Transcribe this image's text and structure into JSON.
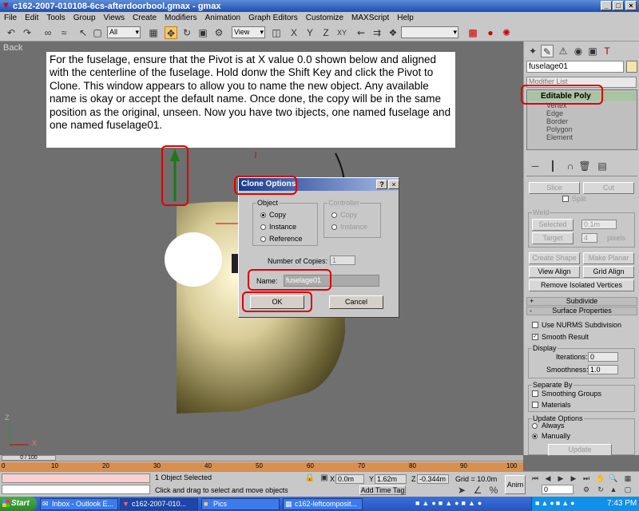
{
  "window": {
    "title": "c162-2007-010108-6cs-afterdoorbool.gmax - gmax",
    "min": "_",
    "max": "□",
    "close": "×"
  },
  "menu": [
    "File",
    "Edit",
    "Tools",
    "Group",
    "Views",
    "Create",
    "Modifiers",
    "Animation",
    "Graph Editors",
    "Customize",
    "MAXScript",
    "Help"
  ],
  "toolbar": {
    "filter_value": "All",
    "coord_value": "View"
  },
  "viewport": {
    "label": "Back",
    "instruction": "For the fuselage, ensure that the Pivot is at X value 0.0 shown below and aligned with the centerline of the fuselage.  Hold donw the Shift Key and click the Pivot to Clone.  This window appears to allow you to name the new object.  Any available name is okay or accept the default name.  Once done, the copy will be in the same position as the original, unseen.  Now you have two ibjects, one named fuselage and one named fuselage01.",
    "axis_z": "Z",
    "axis_x": "X"
  },
  "dialog": {
    "title": "Clone Options",
    "help": "?",
    "close": "×",
    "object_label": "Object",
    "object_options": [
      "Copy",
      "Instance",
      "Reference"
    ],
    "controller_label": "Controller",
    "controller_options": [
      "Copy",
      "Instance"
    ],
    "copies_label": "Number of Copies:",
    "copies_value": "1",
    "name_label": "Name:",
    "name_value": "fuselage01",
    "ok": "OK",
    "cancel": "Cancel"
  },
  "panel": {
    "object_name": "fuselage01",
    "modifier_list": "Modifier List",
    "stack_top": "Editable Poly",
    "stack_items": [
      "Vertex",
      "Edge",
      "Border",
      "Polygon",
      "Element"
    ],
    "slice": "Slice",
    "cut": "Cut",
    "split": "Split",
    "weld": "Weld",
    "selected": "Selected",
    "weld_value": "0.1m",
    "target": "Target",
    "target_value": "4",
    "pixels": "pixels",
    "create_shape": "Create Shape",
    "make_planar": "Make Planar",
    "view_align": "View Align",
    "grid_align": "Grid Align",
    "remove_isolated": "Remove Isolated Vertices",
    "subdivide": "Subdivide",
    "surface_properties": "Surface Properties",
    "use_nurms": "Use NURMS Subdivision",
    "smooth_result": "Smooth Result",
    "display": "Display",
    "iterations": "Iterations:",
    "iterations_value": "0",
    "smoothness": "Smoothness:",
    "smoothness_value": "1.0",
    "separate_by": "Separate By",
    "smoothing_groups": "Smoothing Groups",
    "materials": "Materials",
    "update_options": "Update Options",
    "always": "Always",
    "manually": "Manually",
    "update": "Update",
    "plus": "+",
    "minus": "-"
  },
  "timeline": {
    "frame": "0 / 100",
    "ticks": [
      "0",
      "10",
      "20",
      "30",
      "40",
      "50",
      "60",
      "70",
      "80",
      "90",
      "100"
    ]
  },
  "status": {
    "selected": "1 Object Selected",
    "prompt": "Click and drag to select and move objects",
    "x_label": "X",
    "x_value": "0.0m",
    "y_label": "Y",
    "y_value": "1.62m",
    "z_label": "Z",
    "z_value": "-0.344m",
    "grid": "Grid = 10.0m",
    "add_time_tag": "Add Time Tag",
    "anim": "Anim",
    "frame_value": "0"
  },
  "taskbar": {
    "start": "Start",
    "tasks": [
      "Inbox - Outlook E...",
      "c162-2007-010...",
      "Pics",
      "c162-leftcomposit..."
    ],
    "clock": "7:43 PM"
  }
}
